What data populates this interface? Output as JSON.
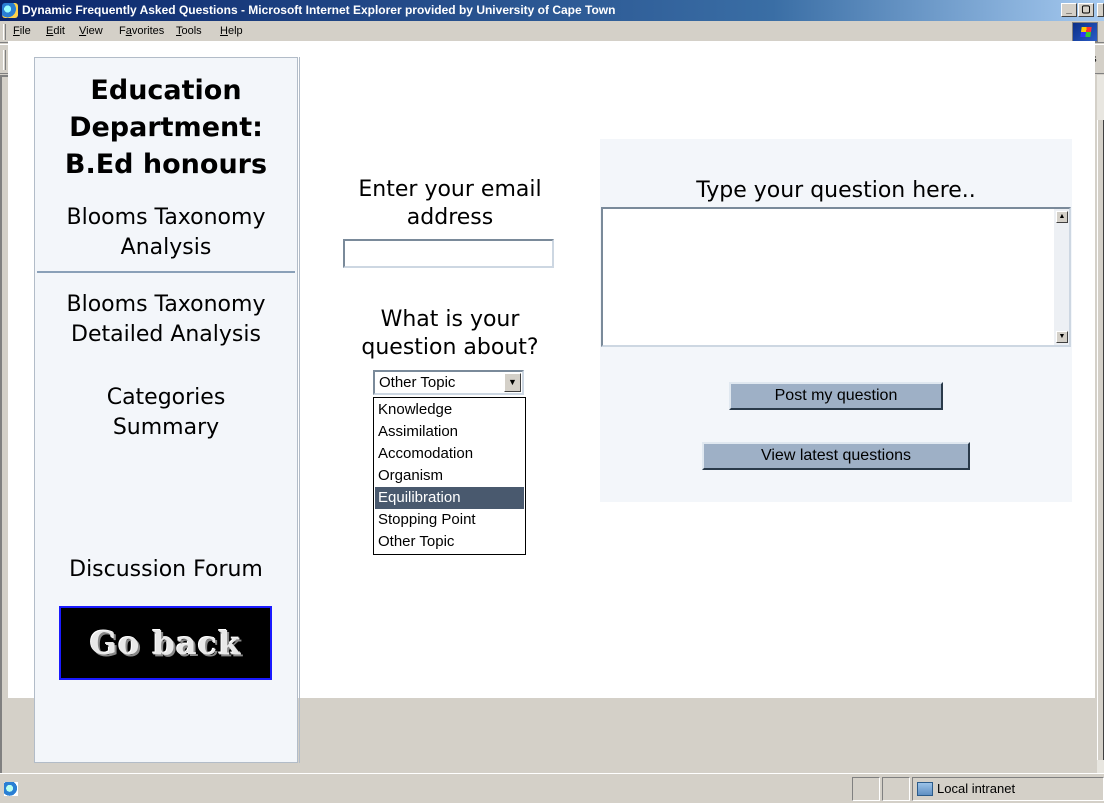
{
  "window": {
    "title": "Dynamic Frequently Asked Questions - Microsoft Internet Explorer provided by University of Cape Town",
    "minimize_glyph": "_",
    "maximize_glyph": "▢",
    "close_glyph": "x"
  },
  "menu": {
    "items": [
      {
        "label": "File",
        "accel": "F"
      },
      {
        "label": "Edit",
        "accel": "E"
      },
      {
        "label": "View",
        "accel": "V"
      },
      {
        "label": "Favorites",
        "accel": "a"
      },
      {
        "label": "Tools",
        "accel": "T"
      },
      {
        "label": "Help",
        "accel": "H"
      }
    ]
  },
  "toolbar": {
    "icons": [
      "back-icon",
      "forward-icon",
      "stop-icon",
      "refresh-icon",
      "home-icon",
      "search-icon",
      "favorites-icon",
      "history-icon",
      "fullscreen-icon",
      "mail-icon",
      "print-icon",
      "edit-icon",
      "messenger-icon",
      "discuss-icon"
    ],
    "glyphs": {
      "back": "⇦",
      "forward": "⇨",
      "drop": "▾",
      "stop": "✕",
      "refresh": "⟳",
      "home": "⌂",
      "search": "⚲",
      "favorites": "▣",
      "history": "◷",
      "fullscreen": "▭",
      "mail": "✉",
      "print": "⎙",
      "edit": "✎",
      "messenger": "☺",
      "discuss": "✦"
    },
    "links_label": "Links"
  },
  "sidebar": {
    "title": "Education Department: B.Ed honours",
    "title_lines": [
      "Education",
      "Department:",
      "B.Ed honours"
    ],
    "links": [
      {
        "lines": [
          "Blooms Taxonomy",
          "Analysis"
        ]
      },
      {
        "lines": [
          "Blooms Taxonomy",
          "Detailed Analysis"
        ]
      },
      {
        "lines": [
          "Categories",
          "Summary"
        ]
      },
      {
        "lines": [
          "Discussion Forum"
        ]
      }
    ],
    "go_back_label": "Go back"
  },
  "form": {
    "email_label_lines": [
      "Enter your email",
      "address"
    ],
    "email_value": "",
    "topic_label_lines": [
      "What is your",
      "question about?"
    ],
    "topic_selected": "Other Topic",
    "topic_options": [
      "Knowledge",
      "Assimilation",
      "Accomodation",
      "Organism",
      "Equilibration",
      "Stopping Point",
      "Other Topic"
    ],
    "topic_highlighted": "Equilibration",
    "question_label": "Type your question here..",
    "question_value": "",
    "post_button": "Post my question",
    "view_button": "View latest questions",
    "select_arrow_glyph": "▼",
    "scroll_up_glyph": "▲",
    "scroll_down_glyph": "▼"
  },
  "status": {
    "text": "",
    "zone": "Local intranet"
  }
}
